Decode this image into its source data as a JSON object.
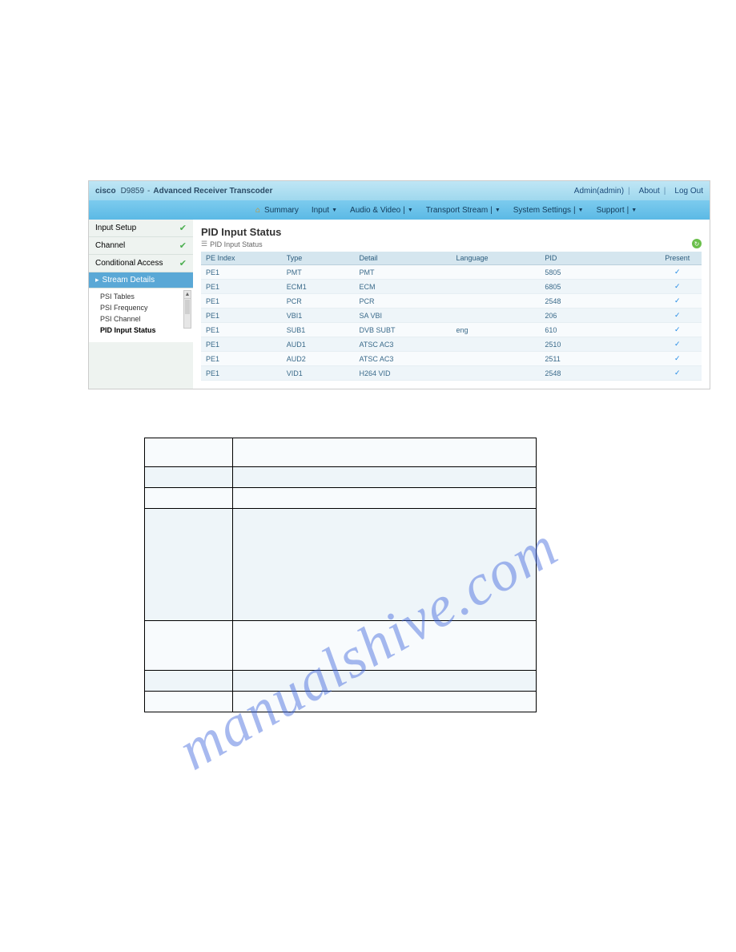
{
  "watermark": "manualshive.com",
  "header": {
    "brand": "cisco",
    "product": "D9859",
    "dash": "-",
    "title": "Advanced Receiver Transcoder",
    "user": "Admin(admin)",
    "about": "About",
    "logout": "Log Out"
  },
  "nav": {
    "summary": "Summary",
    "input": "Input",
    "audio_video": "Audio & Video",
    "transport": "Transport Stream",
    "system": "System Settings",
    "support": "Support"
  },
  "sidebar": {
    "input_setup": "Input Setup",
    "channel": "Channel",
    "conditional": "Conditional Access",
    "stream_details": "Stream Details",
    "sub": {
      "psi_tables": "PSI Tables",
      "psi_frequency": "PSI Frequency",
      "psi_channel": "PSI Channel",
      "pid_input_status": "PID Input Status"
    }
  },
  "content": {
    "heading": "PID Input Status",
    "subtitle": "PID Input Status",
    "columns": {
      "pe_index": "PE Index",
      "type": "Type",
      "detail": "Detail",
      "language": "Language",
      "pid": "PID",
      "present": "Present"
    },
    "rows": [
      {
        "pe": "PE1",
        "type": "PMT",
        "detail": "PMT",
        "lang": "",
        "pid": "5805",
        "present": "✓"
      },
      {
        "pe": "PE1",
        "type": "ECM1",
        "detail": "ECM",
        "lang": "",
        "pid": "6805",
        "present": "✓"
      },
      {
        "pe": "PE1",
        "type": "PCR",
        "detail": "PCR",
        "lang": "",
        "pid": "2548",
        "present": "✓"
      },
      {
        "pe": "PE1",
        "type": "VBI1",
        "detail": "SA VBI",
        "lang": "",
        "pid": "206",
        "present": "✓"
      },
      {
        "pe": "PE1",
        "type": "SUB1",
        "detail": "DVB SUBT",
        "lang": "eng",
        "pid": "610",
        "present": "✓"
      },
      {
        "pe": "PE1",
        "type": "AUD1",
        "detail": "ATSC AC3",
        "lang": "",
        "pid": "2510",
        "present": "✓"
      },
      {
        "pe": "PE1",
        "type": "AUD2",
        "detail": "ATSC AC3",
        "lang": "",
        "pid": "2511",
        "present": "✓"
      },
      {
        "pe": "PE1",
        "type": "VID1",
        "detail": "H264 VID",
        "lang": "",
        "pid": "2548",
        "present": "✓"
      }
    ]
  }
}
